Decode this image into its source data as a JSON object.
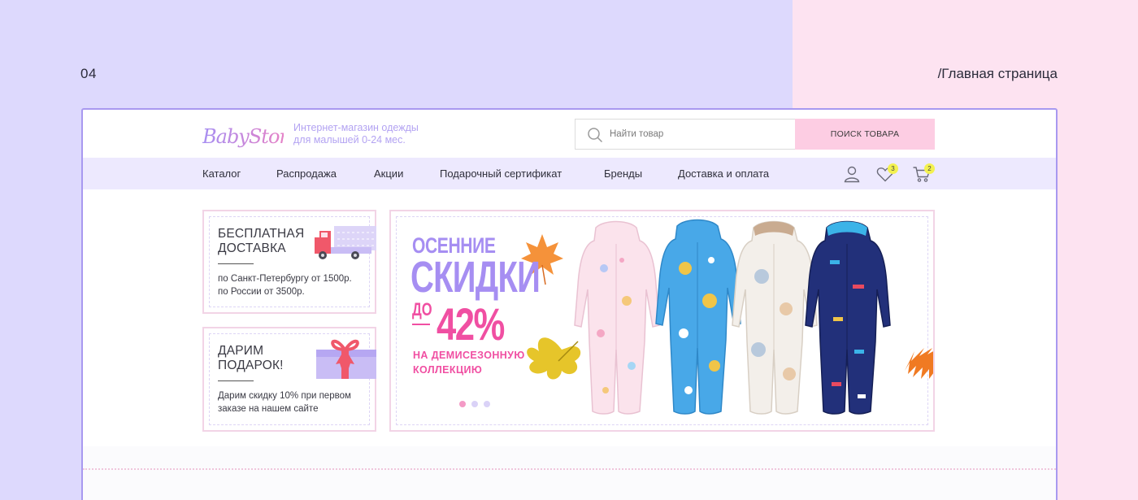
{
  "slide": {
    "number": "04",
    "path": "/Главная страница"
  },
  "header": {
    "logo_text": "BabyStore",
    "tagline_line1": "Интернет-магазин одежды",
    "tagline_line2": "для малышей 0-24 мес.",
    "search": {
      "placeholder": "Найти товар",
      "button_label": "ПОИСК ТОВАРА"
    }
  },
  "nav": {
    "items": [
      {
        "label": "Каталог"
      },
      {
        "label": "Распродажа"
      },
      {
        "label": "Акции"
      },
      {
        "label": "Подарочный сертификат"
      },
      {
        "label": "Бренды"
      },
      {
        "label": "Доставка и оплата"
      }
    ],
    "icons": {
      "account": "user-icon",
      "favorites": "heart-icon",
      "cart": "cart-icon"
    },
    "favorites_count": "3",
    "cart_count": "2"
  },
  "promos": [
    {
      "title_line1": "БЕСПЛАТНАЯ",
      "title_line2": "ДОСТАВКА",
      "text_line1": "по Санкт-Петербургу от 1500р.",
      "text_line2": "по России от 3500р.",
      "icon": "truck-icon"
    },
    {
      "title_line1": "ДАРИМ",
      "title_line2": "ПОДАРОК!",
      "text_line1": "Дарим скидку 10% при первом",
      "text_line2": "заказе на нашем сайте",
      "icon": "gift-icon"
    }
  ],
  "banner": {
    "line1": "ОСЕННИЕ",
    "line2": "СКИДКИ",
    "upto": "ДО",
    "percent": "42%",
    "sub_line1": "НА ДЕМИСЕЗОННУЮ",
    "sub_line2": "КОЛЛЕКЦИЮ",
    "active_slide": 1,
    "slide_count": 3
  },
  "colors": {
    "bg_left": "#ddd9fd",
    "bg_right": "#fde3f1",
    "frame_border": "#a899f0",
    "nav_bg": "#ede9fe",
    "accent_purple": "#a68ef2",
    "accent_pink": "#f04fa2",
    "search_button": "#fdcde3",
    "badge": "#f3f14f"
  }
}
